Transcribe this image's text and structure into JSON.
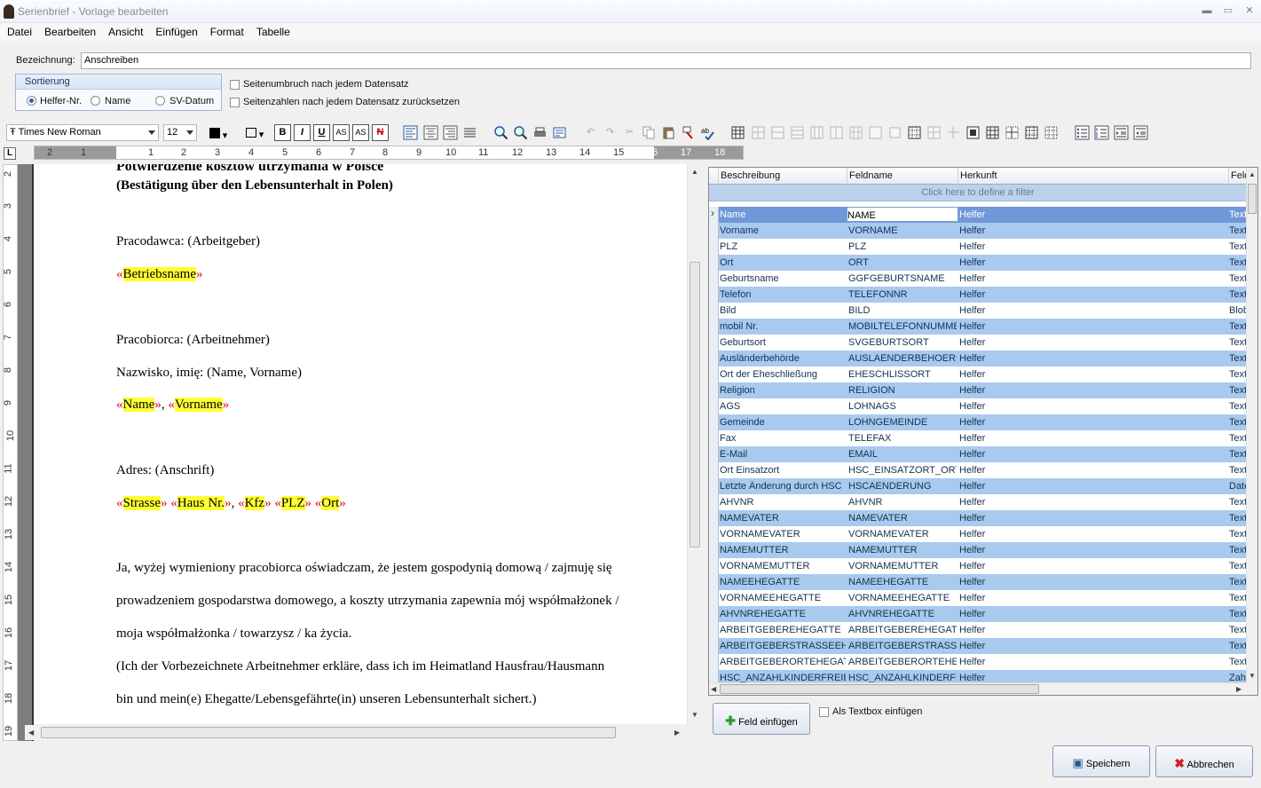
{
  "window": {
    "title": "Serienbrief - Vorlage bearbeiten"
  },
  "menu": [
    "Datei",
    "Bearbeiten",
    "Ansicht",
    "Einfügen",
    "Format",
    "Tabelle"
  ],
  "bezeichnung": {
    "label": "Bezeichnung:",
    "value": "Anschreiben"
  },
  "sortierung": {
    "caption": "Sortierung",
    "options": [
      "Helfer-Nr.",
      "Name",
      "SV-Datum"
    ],
    "selected": "Helfer-Nr."
  },
  "options": {
    "page_break": "Seitenumbruch nach jedem Datensatz",
    "reset_page_numbers": "Seitenzahlen nach jedem Datensatz zurücksetzen"
  },
  "toolbar": {
    "font": "Times New Roman",
    "size": "12",
    "font_icon": "Ŧ",
    "bold": "B",
    "italic": "I",
    "underline": "U",
    "superscript": "AS",
    "subscript": "AS",
    "strike": "N"
  },
  "ruler": {
    "h": [
      "2",
      "1",
      "1",
      "2",
      "3",
      "4",
      "5",
      "6",
      "7",
      "8",
      "9",
      "10",
      "11",
      "12",
      "13",
      "14",
      "15",
      "16",
      "17",
      "18"
    ],
    "v": [
      "2",
      "3",
      "4",
      "5",
      "6",
      "7",
      "8",
      "9",
      "10",
      "11",
      "12",
      "13",
      "14",
      "15",
      "16",
      "17",
      "18",
      "19"
    ],
    "corner": "L"
  },
  "document": {
    "title_pl": "Potwierdzenie kosztów utrzymania w Polsce",
    "title_de": "(Bestätigung über den Lebensunterhalt in Polen)",
    "employer": "Pracodawca: (Arbeitgeber)",
    "employer_field": "Betriebsname",
    "employee": "Pracobiorca: (Arbeitnehmer)",
    "name_line": "Nazwisko, imię:  (Name, Vorname)",
    "field_name": "Name",
    "field_vorname": "Vorname",
    "address": "Adres: (Anschrift)",
    "field_strasse": "Strasse",
    "field_hausnr": "Haus Nr.",
    "field_kfz": "Kfz",
    "field_plz": "PLZ",
    "field_ort": "Ort",
    "p1": "Ja, wyżej wymieniony pracobiorca oświadczam, że jestem gospodynią domową / zajmuję się",
    "p2": "prowadzeniem gospodarstwa domowego, a koszty utrzymania zapewnia mój współmałżonek /",
    "p3": "moja współmałżonka / towarzysz / ka życia.",
    "p4": "(Ich der Vorbezeichnete Arbeitnehmer erkläre, dass ich im Heimatland Hausfrau/Hausmann",
    "p5": "bin und mein(e) Ehegatte/Lebensgefährte(in) unseren Lebensunterhalt sichert.)"
  },
  "grid": {
    "columns": [
      "Beschreibung",
      "Feldname",
      "Herkunft",
      "Feld"
    ],
    "filter_hint": "Click here to define a filter",
    "rows": [
      [
        "Name",
        "NAME",
        "Helfer",
        "Text"
      ],
      [
        "Vorname",
        "VORNAME",
        "Helfer",
        "Text"
      ],
      [
        "PLZ",
        "PLZ",
        "Helfer",
        "Text"
      ],
      [
        "Ort",
        "ORT",
        "Helfer",
        "Text"
      ],
      [
        "Geburtsname",
        "GGFGEBURTSNAME",
        "Helfer",
        "Text"
      ],
      [
        "Telefon",
        "TELEFONNR",
        "Helfer",
        "Text"
      ],
      [
        "Bild",
        "BILD",
        "Helfer",
        "Blob"
      ],
      [
        "mobil Nr.",
        "MOBILTELEFONNUMMER",
        "Helfer",
        "Text"
      ],
      [
        "Geburtsort",
        "SVGEBURTSORT",
        "Helfer",
        "Text"
      ],
      [
        "Ausländerbehörde",
        "AUSLAENDERBEHOERDE",
        "Helfer",
        "Text"
      ],
      [
        "Ort der Eheschließung",
        "EHESCHLISSORT",
        "Helfer",
        "Text"
      ],
      [
        "Religion",
        "RELIGION",
        "Helfer",
        "Text"
      ],
      [
        "AGS",
        "LOHNAGS",
        "Helfer",
        "Text"
      ],
      [
        "Gemeinde",
        "LOHNGEMEINDE",
        "Helfer",
        "Text"
      ],
      [
        "Fax",
        "TELEFAX",
        "Helfer",
        "Text"
      ],
      [
        "E-Mail",
        "EMAIL",
        "Helfer",
        "Text"
      ],
      [
        "Ort Einsatzort",
        "HSC_EINSATZORT_ORT",
        "Helfer",
        "Text"
      ],
      [
        "Letzte Änderung durch HSC",
        "HSCAENDERUNG",
        "Helfer",
        "Date"
      ],
      [
        "AHVNR",
        "AHVNR",
        "Helfer",
        "Text"
      ],
      [
        "NAMEVATER",
        "NAMEVATER",
        "Helfer",
        "Text"
      ],
      [
        "VORNAMEVATER",
        "VORNAMEVATER",
        "Helfer",
        "Text"
      ],
      [
        "NAMEMUTTER",
        "NAMEMUTTER",
        "Helfer",
        "Text"
      ],
      [
        "VORNAMEMUTTER",
        "VORNAMEMUTTER",
        "Helfer",
        "Text"
      ],
      [
        "NAMEEHEGATTE",
        "NAMEEHEGATTE",
        "Helfer",
        "Text"
      ],
      [
        "VORNAMEEHEGATTE",
        "VORNAMEEHEGATTE",
        "Helfer",
        "Text"
      ],
      [
        "AHVNREHEGATTE",
        "AHVNREHEGATTE",
        "Helfer",
        "Text"
      ],
      [
        "ARBEITGEBEREHEGATTE",
        "ARBEITGEBEREHEGATTE",
        "Helfer",
        "Text"
      ],
      [
        "ARBEITGEBERSTRASSEEHEGATTE",
        "ARBEITGEBERSTRASSEEHEGATTE",
        "Helfer",
        "Text"
      ],
      [
        "ARBEITGEBERORTEHEGATTE",
        "ARBEITGEBERORTEHEGATTE",
        "Helfer",
        "Text"
      ],
      [
        "HSC_ANZAHLKINDERFREIBETRAG",
        "HSC_ANZAHLKINDERFREIBETRAG",
        "Helfer",
        "Zahl"
      ]
    ]
  },
  "bottom": {
    "insert_field": "Feld einfügen",
    "as_textbox": "Als Textbox einfügen",
    "save": "Speichern",
    "cancel": "Abbrechen"
  },
  "colors": {
    "selection": "#6f98d8",
    "alt_row": "#a9c9ef",
    "merge_highlight": "#ffff33"
  }
}
